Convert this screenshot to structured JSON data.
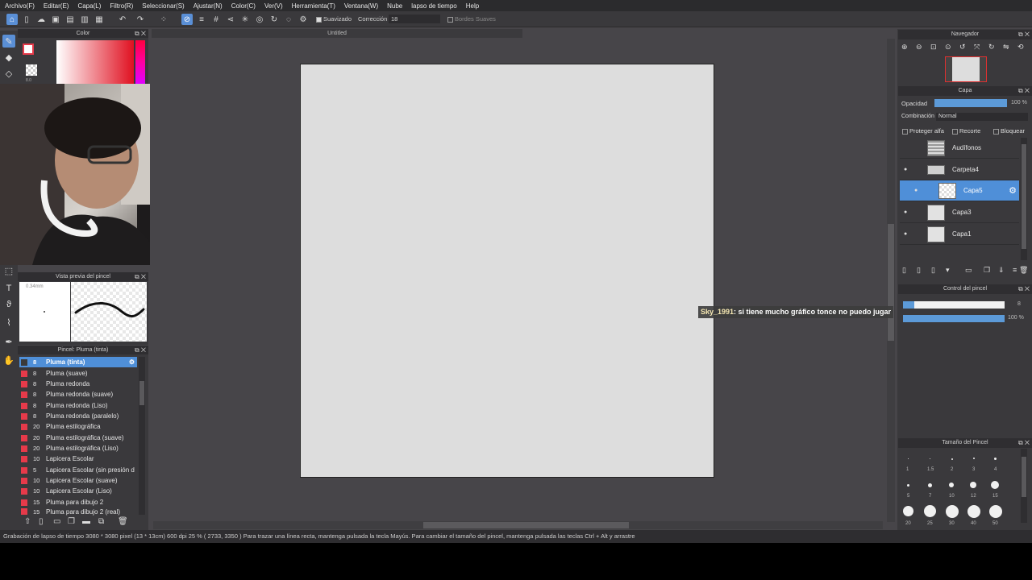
{
  "menubar": [
    "Archivo(F)",
    "Editar(E)",
    "Capa(L)",
    "Filtro(R)",
    "Seleccionar(S)",
    "Ajustar(N)",
    "Color(C)",
    "Ver(V)",
    "Herramienta(T)",
    "Ventana(W)",
    "Nube",
    "lapso de tiempo",
    "Help"
  ],
  "toolbar": {
    "smoothing_label": "Suavizado",
    "correction_label": "Corrección",
    "correction_value": "18",
    "soft_edges_label": "Bordes Suaves"
  },
  "color_panel": {
    "title": "Color",
    "tiny_label": "8.0"
  },
  "brush_preview": {
    "title": "Vista previa del pincel",
    "size_label": "0.34mm"
  },
  "brush_list": {
    "title": "Pincel: Pluma (tinta)",
    "items": [
      {
        "size": "8",
        "name": "Pluma (tinta)"
      },
      {
        "size": "8",
        "name": "Pluma (suave)"
      },
      {
        "size": "8",
        "name": "Pluma redonda"
      },
      {
        "size": "8",
        "name": "Pluma redonda (suave)"
      },
      {
        "size": "8",
        "name": "Pluma redonda (Liso)"
      },
      {
        "size": "8",
        "name": "Pluma redonda (paralelo)"
      },
      {
        "size": "20",
        "name": "Pluma estilográfica"
      },
      {
        "size": "20",
        "name": "Pluma estilográfica (suave)"
      },
      {
        "size": "20",
        "name": "Pluma estilográfica (Liso)"
      },
      {
        "size": "10",
        "name": "Lapicera Escolar"
      },
      {
        "size": "5",
        "name": "Lapicera Escolar (sin presión d"
      },
      {
        "size": "10",
        "name": "Lapicera Escolar (suave)"
      },
      {
        "size": "10",
        "name": "Lapicera Escolar (Liso)"
      },
      {
        "size": "15",
        "name": "Pluma para dibujo 2"
      },
      {
        "size": "15",
        "name": "Pluma para dibujo 2 (real)"
      }
    ]
  },
  "canvas": {
    "tab_title": "Untitled"
  },
  "navigator": {
    "title": "Navegador"
  },
  "layer_panel": {
    "title": "Capa",
    "opacity_label": "Opacidad",
    "opacity_value": "100 %",
    "blend_label": "Combinación",
    "blend_value": "Normal",
    "protect_alpha": "Proteger alfa",
    "clipping": "Recorte",
    "lock": "Bloquear",
    "layers": [
      {
        "name": "Audífonos"
      },
      {
        "name": "Carpeta4"
      },
      {
        "name": "Capa5"
      },
      {
        "name": "Capa3"
      },
      {
        "name": "Capa1"
      }
    ]
  },
  "brush_control": {
    "title": "Control del pincel",
    "size_value": "8",
    "opacity_value": "100 %"
  },
  "brush_size_panel": {
    "title": "Tamaño del Pincel",
    "labels": [
      "1",
      "1.5",
      "2",
      "3",
      "4",
      "5",
      "7",
      "10",
      "12",
      "15",
      "20",
      "25",
      "30",
      "40",
      "50"
    ]
  },
  "chat": {
    "user": "Sky_1991",
    "message": ": si tiene mucho gráfico tonce no puedo jugar"
  },
  "statusbar": {
    "text": "Grabación de lapso de tiempo  3080 * 3080 pixel  (13 * 13cm)  600 dpi  25 %  ( 2733, 3350 )  Para trazar una línea recta, mantenga pulsada la tecla Mayús. Para cambiar el tamaño del pincel, mantenga pulsada las teclas Ctrl + Alt y arrastre"
  },
  "colors": {
    "accent": "#4f8fd8",
    "brush_swatch": "#e63a4a",
    "paper": "#dddddd",
    "panel": "#3a393c"
  }
}
